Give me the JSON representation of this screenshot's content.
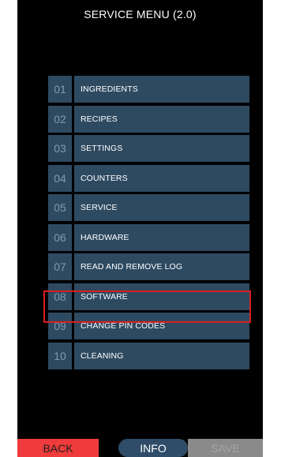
{
  "title": "SERVICE MENU (2.0)",
  "menu": {
    "items": [
      {
        "num": "01",
        "label": "INGREDIENTS"
      },
      {
        "num": "02",
        "label": "RECIPES"
      },
      {
        "num": "03",
        "label": "SETTINGS"
      },
      {
        "num": "04",
        "label": "COUNTERS"
      },
      {
        "num": "05",
        "label": "SERVICE"
      },
      {
        "num": "06",
        "label": "HARDWARE"
      },
      {
        "num": "07",
        "label": "READ AND REMOVE LOG"
      },
      {
        "num": "08",
        "label": "SOFTWARE"
      },
      {
        "num": "09",
        "label": "CHANGE PIN CODES"
      },
      {
        "num": "10",
        "label": "CLEANING"
      }
    ]
  },
  "buttons": {
    "back": "BACK",
    "info": "INFO",
    "save": "SAVE"
  },
  "colors": {
    "menu_bg": "#2e4a61",
    "highlight": "#d8201f",
    "back_bg": "#ef3b3b",
    "save_bg": "#8a8a8a"
  }
}
